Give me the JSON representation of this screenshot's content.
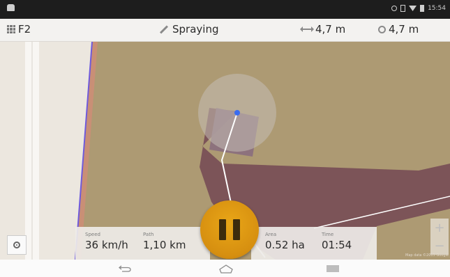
{
  "top_bar": {
    "field_name": "F2",
    "status": "Spraying",
    "working_width": "4,7 m",
    "coverage_width": "4,7 m"
  },
  "status_bar": {
    "time": "15:54"
  },
  "stats": {
    "speed_label": "Speed",
    "speed_value": "36 km/h",
    "path_label": "Path",
    "path_value": "1,10 km",
    "area_label": "Area",
    "area_value": "0.52 ha",
    "time_label": "Time",
    "time_value": "01:54"
  },
  "map": {
    "zoom_in": "+",
    "zoom_out": "−",
    "attribution": "Map data ©2015 Google"
  },
  "colors": {
    "field_brown": "#ad9a73",
    "sprayed_path": "#7c5458",
    "pause_button": "#d68f10"
  },
  "icons": {
    "field": "grid-icon",
    "status": "pencil-icon",
    "working_width": "width-arrow-icon",
    "coverage_width": "target-icon",
    "pause": "pause-icon",
    "locate": "locate-icon"
  }
}
